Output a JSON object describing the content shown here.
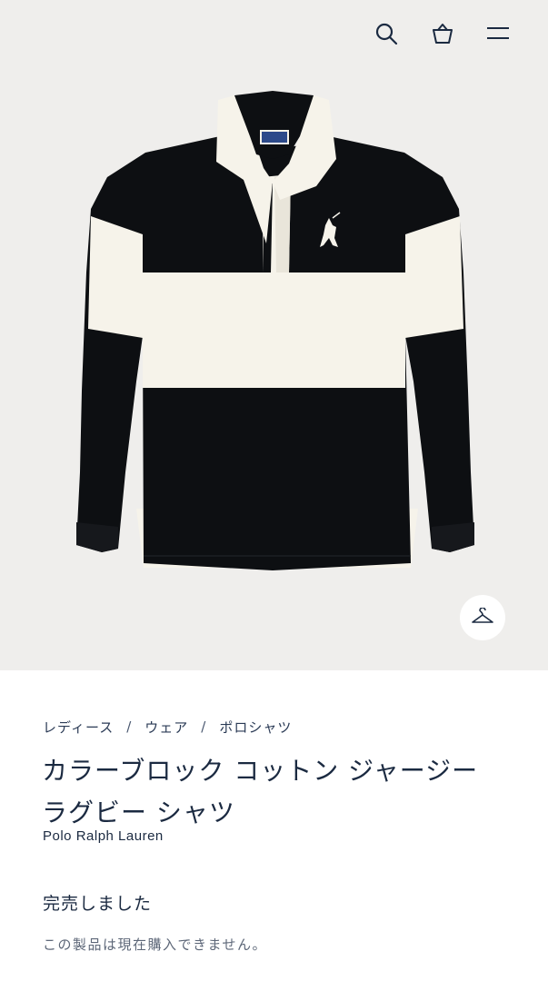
{
  "header": {
    "icons": [
      "search-icon",
      "shopping-bag-icon",
      "menu-icon"
    ]
  },
  "product_image": {
    "description_colors": {
      "body": "#0d0f12",
      "stripe": "#f6f3ea",
      "collar": "#f6f3ea",
      "logo_tag": "#2d4a8a"
    }
  },
  "breadcrumb": {
    "items": [
      "レディース",
      "ウェア",
      "ポロシャツ"
    ],
    "separator": "/"
  },
  "product": {
    "title": "カラーブロック コットン ジャージー ラグビー シャツ",
    "brand": "Polo Ralph Lauren",
    "status": "完売しました",
    "availability_note": "この製品は現在購入できません。"
  }
}
